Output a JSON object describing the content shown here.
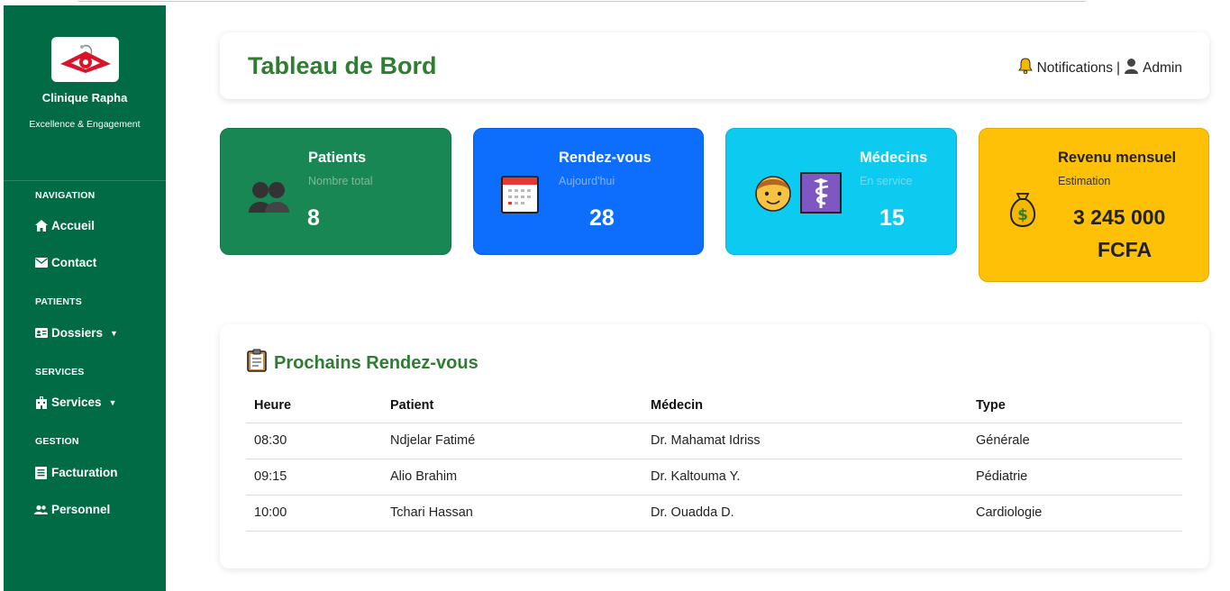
{
  "brand": {
    "name": "Clinique Rapha",
    "tagline": "Excellence & Engagement"
  },
  "nav": {
    "sections": [
      "NAVIGATION",
      "PATIENTS",
      "SERVICES",
      "GESTION"
    ],
    "items": [
      {
        "label": "Accueil",
        "icon": "home-icon"
      },
      {
        "label": "Contact",
        "icon": "envelope-icon"
      },
      {
        "label": "Dossiers",
        "icon": "id-card-icon",
        "dropdown": true
      },
      {
        "label": "Services",
        "icon": "hospital-icon",
        "dropdown": true
      },
      {
        "label": "Facturation",
        "icon": "invoice-icon"
      },
      {
        "label": "Personnel",
        "icon": "users-icon"
      }
    ]
  },
  "header": {
    "title": "Tableau de Bord",
    "notifications": "Notifications",
    "separator": "|",
    "user": "Admin"
  },
  "stats": [
    {
      "title": "Patients",
      "subtitle": "Nombre total",
      "value": "8",
      "color": "#198754",
      "icon": "people-icon"
    },
    {
      "title": "Rendez-vous",
      "subtitle": "Aujourd'hui",
      "value": "28",
      "color": "#0d6efd",
      "icon": "calendar-icon"
    },
    {
      "title": "Médecins",
      "subtitle": "En service",
      "value": "15",
      "color": "#0dcaf0",
      "icon": "doctor-icon"
    },
    {
      "title": "Revenu mensuel",
      "subtitle": "Estimation",
      "value": "3 245 000",
      "value2": "FCFA",
      "color": "#ffc107",
      "icon": "money-bag-icon"
    }
  ],
  "appointments": {
    "title": "Prochains Rendez-vous",
    "columns": [
      "Heure",
      "Patient",
      "Médecin",
      "Type"
    ],
    "rows": [
      [
        "08:30",
        "Ndjelar Fatimé",
        "Dr. Mahamat Idriss",
        "Générale"
      ],
      [
        "09:15",
        "Alio Brahim",
        "Dr. Kaltouma Y.",
        "Pédiatrie"
      ],
      [
        "10:00",
        "Tchari Hassan",
        "Dr. Ouadda D.",
        "Cardiologie"
      ]
    ]
  }
}
